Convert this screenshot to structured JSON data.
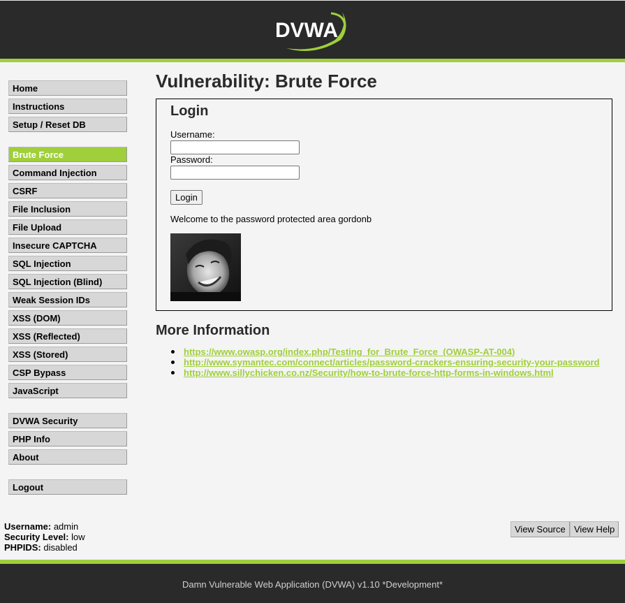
{
  "header": {
    "logo_text": "DVWA",
    "logo_icon": "dvwa-swoosh-logo"
  },
  "menu": {
    "group1": [
      "Home",
      "Instructions",
      "Setup / Reset DB"
    ],
    "group2": [
      "Brute Force",
      "Command Injection",
      "CSRF",
      "File Inclusion",
      "File Upload",
      "Insecure CAPTCHA",
      "SQL Injection",
      "SQL Injection (Blind)",
      "Weak Session IDs",
      "XSS (DOM)",
      "XSS (Reflected)",
      "XSS (Stored)",
      "CSP Bypass",
      "JavaScript"
    ],
    "group3": [
      "DVWA Security",
      "PHP Info",
      "About"
    ],
    "group4": [
      "Logout"
    ],
    "selected": "Brute Force"
  },
  "main": {
    "title": "Vulnerability: Brute Force",
    "login": {
      "heading": "Login",
      "username_label": "Username:",
      "username_value": "",
      "password_label": "Password:",
      "password_value": "",
      "button_label": "Login",
      "welcome": "Welcome to the password protected area gordonb"
    },
    "more_info_heading": "More Information",
    "links": [
      "https://www.owasp.org/index.php/Testing_for_Brute_Force_(OWASP-AT-004)",
      "http://www.symantec.com/connect/articles/password-crackers-ensuring-security-your-password",
      "http://www.sillychicken.co.nz/Security/how-to-brute-force-http-forms-in-windows.html"
    ]
  },
  "system_info": {
    "username_label": "Username:",
    "username_value": "admin",
    "security_label": "Security Level:",
    "security_value": "low",
    "phpids_label": "PHPIDS:",
    "phpids_value": "disabled"
  },
  "buttons": {
    "view_source": "View Source",
    "view_help": "View Help"
  },
  "footer": {
    "text": "Damn Vulnerable Web Application (DVWA) v1.10 *Development*"
  },
  "colors": {
    "accent": "#9fcf3a",
    "header_bg": "#2a2a2a",
    "menu_bg": "#d7d7d7",
    "page_bg": "#f4f4f4"
  }
}
